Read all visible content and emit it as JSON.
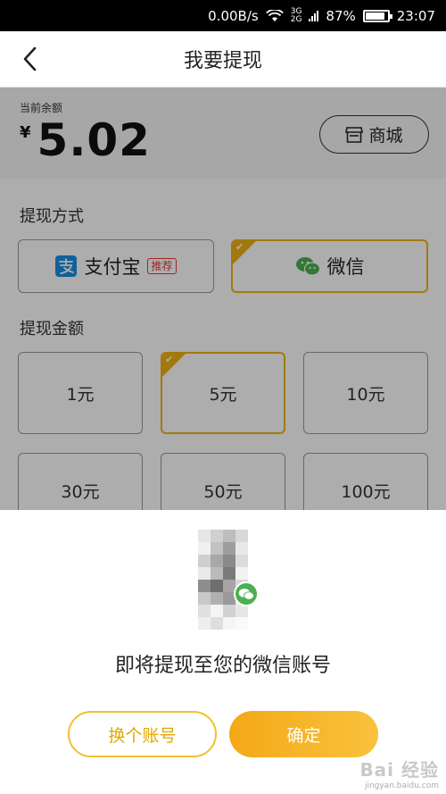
{
  "status_bar": {
    "speed": "0.00B/s",
    "network_top": "3G",
    "network_bottom": "2G",
    "battery": "87%",
    "time": "23:07"
  },
  "nav": {
    "title": "我要提现",
    "back_icon": "chevron-left-icon"
  },
  "balance": {
    "label": "当前余额",
    "currency": "¥",
    "amount": "5.02",
    "shop_label": "商城",
    "shop_icon": "store-icon"
  },
  "method": {
    "title": "提现方式",
    "options": [
      {
        "label": "支付宝",
        "icon": "alipay-icon",
        "tag": "推荐",
        "selected": false
      },
      {
        "label": "微信",
        "icon": "wechat-icon",
        "selected": true
      }
    ]
  },
  "amount_section": {
    "title": "提现金额",
    "options": [
      {
        "label": "1元",
        "selected": false
      },
      {
        "label": "5元",
        "selected": true
      },
      {
        "label": "10元",
        "selected": false
      },
      {
        "label": "30元",
        "selected": false
      },
      {
        "label": "50元",
        "selected": false
      },
      {
        "label": "100元",
        "selected": false
      }
    ]
  },
  "sheet": {
    "message": "即将提现至您的微信账号",
    "switch_label": "换个账号",
    "confirm_label": "确定"
  },
  "watermark": {
    "main": "Bai 经验",
    "sub": "jingyan.baidu.com"
  },
  "colors": {
    "accent": "#f0b315",
    "confirm_start": "#f4a817",
    "confirm_end": "#f9c23c",
    "alipay": "#1a8fe0",
    "wechat": "#4caf50",
    "tag_red": "#e53935"
  }
}
